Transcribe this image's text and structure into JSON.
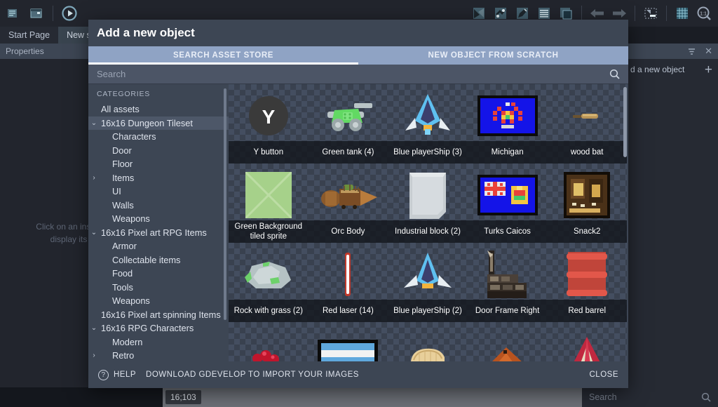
{
  "app": {
    "toolbar_left": [
      {
        "name": "project-manager-icon",
        "label": "Project Manager"
      },
      {
        "name": "scene-editor-icon",
        "label": "Scene Editor"
      },
      {
        "name": "preview-play-icon",
        "label": "Preview"
      }
    ],
    "toolbar_right": [
      {
        "name": "select-tool-icon",
        "label": "Select"
      },
      {
        "name": "move-tool-icon",
        "label": "Move"
      },
      {
        "name": "edit-tool-icon",
        "label": "Edit"
      },
      {
        "name": "list-objects-icon",
        "label": "Objects list"
      },
      {
        "name": "layers-icon",
        "label": "Layers"
      },
      {
        "name": "undo-icon",
        "label": "Undo"
      },
      {
        "name": "redo-icon",
        "label": "Redo"
      },
      {
        "name": "resize-icon",
        "label": "Resize"
      },
      {
        "name": "grid-icon",
        "label": "Grid"
      },
      {
        "name": "zoom-reset-icon",
        "label": "Zoom 1:1"
      }
    ],
    "tabs": [
      {
        "label": "Start Page",
        "active": false
      },
      {
        "label": "New sce",
        "active": true
      }
    ],
    "properties_panel": {
      "title": "Properties"
    },
    "canvas_hint_line1": "Click on an instance",
    "canvas_hint_line2": "display its pr",
    "right_panel": {
      "row_label": "d a new object",
      "add_label": "+"
    },
    "status": {
      "coordinates": "16;103",
      "search_placeholder": "Search"
    }
  },
  "dialog": {
    "title": "Add a new object",
    "tabs": [
      {
        "label": "SEARCH ASSET STORE",
        "active": true
      },
      {
        "label": "NEW OBJECT FROM SCRATCH",
        "active": false
      }
    ],
    "search_placeholder": "Search",
    "categories_title": "CATEGORIES",
    "categories": [
      {
        "label": "All assets",
        "level": 0,
        "arrow": "",
        "selected": false
      },
      {
        "label": "16x16 Dungeon Tileset",
        "level": 0,
        "arrow": "v",
        "selected": true
      },
      {
        "label": "Characters",
        "level": 1,
        "arrow": "",
        "selected": false
      },
      {
        "label": "Door",
        "level": 1,
        "arrow": "",
        "selected": false
      },
      {
        "label": "Floor",
        "level": 1,
        "arrow": "",
        "selected": false
      },
      {
        "label": "Items",
        "level": 1,
        "arrow": ">",
        "selected": false
      },
      {
        "label": "UI",
        "level": 1,
        "arrow": "",
        "selected": false
      },
      {
        "label": "Walls",
        "level": 1,
        "arrow": "",
        "selected": false
      },
      {
        "label": "Weapons",
        "level": 1,
        "arrow": "",
        "selected": false
      },
      {
        "label": "16x16 Pixel art RPG Items",
        "level": 0,
        "arrow": "v",
        "selected": false
      },
      {
        "label": "Armor",
        "level": 1,
        "arrow": "",
        "selected": false
      },
      {
        "label": "Collectable items",
        "level": 1,
        "arrow": "",
        "selected": false
      },
      {
        "label": "Food",
        "level": 1,
        "arrow": "",
        "selected": false
      },
      {
        "label": "Tools",
        "level": 1,
        "arrow": "",
        "selected": false
      },
      {
        "label": "Weapons",
        "level": 1,
        "arrow": "",
        "selected": false
      },
      {
        "label": "16x16 Pixel art spinning Items",
        "level": 0,
        "arrow": "",
        "selected": false
      },
      {
        "label": "16x16 RPG Characters",
        "level": 0,
        "arrow": "v",
        "selected": false
      },
      {
        "label": "Modern",
        "level": 1,
        "arrow": "",
        "selected": false
      },
      {
        "label": "Retro",
        "level": 1,
        "arrow": ">",
        "selected": false
      }
    ],
    "assets": [
      {
        "name": "Y button",
        "line2": "",
        "art": "y-button"
      },
      {
        "name": "Green tank (4)",
        "line2": "",
        "art": "green-tank"
      },
      {
        "name": "Blue playerShip (3)",
        "line2": "",
        "art": "blue-ship"
      },
      {
        "name": "Michigan",
        "line2": "",
        "art": "flag-michigan"
      },
      {
        "name": "wood bat",
        "line2": "",
        "art": "wood-bat"
      },
      {
        "name": "Green Background",
        "line2": "tiled sprite",
        "art": "green-bg"
      },
      {
        "name": "Orc Body",
        "line2": "",
        "art": "orc-body"
      },
      {
        "name": "Industrial block (2)",
        "line2": "",
        "art": "industrial-block"
      },
      {
        "name": "Turks Caicos",
        "line2": "",
        "art": "flag-turks"
      },
      {
        "name": "Snack2",
        "line2": "",
        "art": "snack2"
      },
      {
        "name": "Rock with grass (2)",
        "line2": "",
        "art": "rock-grass"
      },
      {
        "name": "Red laser (14)",
        "line2": "",
        "art": "red-laser"
      },
      {
        "name": "Blue playerShip (2)",
        "line2": "",
        "art": "blue-ship2"
      },
      {
        "name": "Door Frame Right",
        "line2": "",
        "art": "door-frame"
      },
      {
        "name": "Red barrel",
        "line2": "",
        "art": "red-barrel"
      },
      {
        "name": "",
        "line2": "",
        "art": "red-berries"
      },
      {
        "name": "",
        "line2": "",
        "art": "flag-argentina"
      },
      {
        "name": "",
        "line2": "",
        "art": "bread"
      },
      {
        "name": "",
        "line2": "",
        "art": "dirt-pile"
      },
      {
        "name": "",
        "line2": "",
        "art": "red-tent"
      }
    ],
    "footer": {
      "help_label": "HELP",
      "download_label": "DOWNLOAD GDEVELOP TO IMPORT YOUR IMAGES",
      "close_label": "CLOSE"
    }
  },
  "colors": {
    "dialog_bg": "#3d4654",
    "tab_active": "#8fa3c4",
    "accent": "#ffffff",
    "checker_light": "#444e60",
    "checker_dark": "#39414f"
  }
}
